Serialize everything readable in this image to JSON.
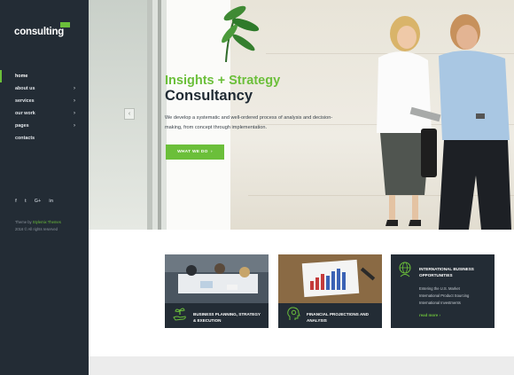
{
  "brand": {
    "logo_text": "consulting",
    "accent_color": "#6bbf3a",
    "sidebar_color": "#232c35"
  },
  "nav": {
    "items": [
      {
        "label": "home",
        "has_submenu": false,
        "active": true
      },
      {
        "label": "about us",
        "has_submenu": true
      },
      {
        "label": "services",
        "has_submenu": true
      },
      {
        "label": "our work",
        "has_submenu": true
      },
      {
        "label": "pages",
        "has_submenu": true
      },
      {
        "label": "contacts",
        "has_submenu": false
      }
    ],
    "chevron": "›"
  },
  "social": {
    "facebook": "f",
    "twitter": "t",
    "google_plus": "G+",
    "linkedin": "in"
  },
  "credits": {
    "prefix": "Theme by ",
    "link": "Stylemix Themes",
    "copyright": "2016 © All rights reserved"
  },
  "hero": {
    "title_green": "Insights + Strategy",
    "title_dark": "Consultancy",
    "description": "We develop a systematic and well-ordered process of analysis and decision-making, from concept through implementation.",
    "button_label": "WHAT WE DO",
    "button_arrow": "›",
    "slider_arrow": "‹"
  },
  "cards": [
    {
      "label": "BUSINESS PLANNING, STRATEGY & EXECUTION",
      "icon": "plant-hand-icon"
    },
    {
      "label": "FINANCIAL PROJECTIONS AND ANALYSIS",
      "icon": "head-gear-icon"
    }
  ],
  "card3": {
    "icon": "globe-person-icon",
    "title": "INTERNATIONAL BUSINESS OPPORTUNITIES",
    "list": [
      "Entering the U.S. Market",
      "International Product Sourcing",
      "International Investments"
    ],
    "more": "read more ›"
  }
}
